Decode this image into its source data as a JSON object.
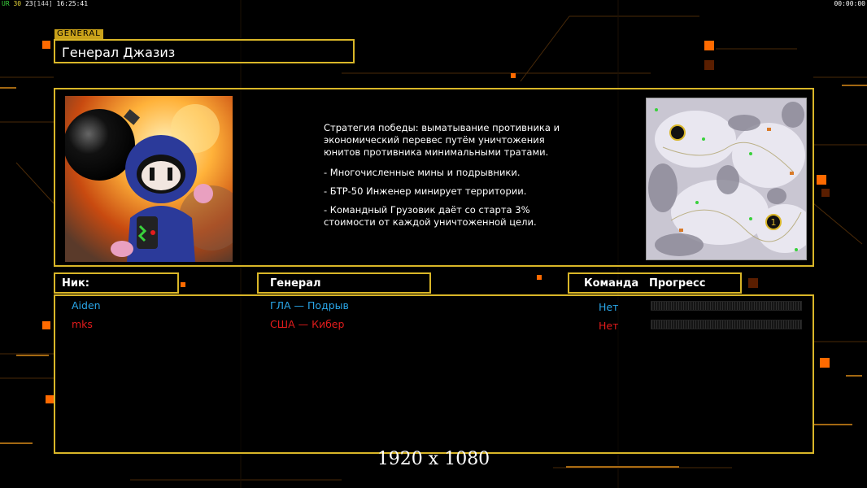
{
  "overlay": {
    "ur_label": "UR",
    "fps_value": "30",
    "cap_value": "23",
    "cap_limit": "[144]",
    "clock": "16:25:41",
    "timer": "00:00:00"
  },
  "general": {
    "tag": "GENERAL",
    "name": "Генерал Джазиз",
    "strategy": "Стратегия победы: выматывание противника и экономический перевес путём уничтожения юнитов противника минимальными тратами.",
    "features": [
      "- Многочисленные мины и подрывники.",
      "- БТР-50 Инженер минирует территории.",
      "- Командный Грузовик даёт со старта 3% стоимости от каждой уничтоженной цели."
    ],
    "portrait_icon": "bomberman-portrait",
    "minimap_icon": "snow-map-minimap"
  },
  "columns": {
    "nick": "Ник:",
    "general": "Генерал",
    "team": "Команда",
    "progress": "Прогресс"
  },
  "players": [
    {
      "nick": "Aiden",
      "general": "ГЛА — Подрыв",
      "team": "Нет",
      "color": "#2aa6e8"
    },
    {
      "nick": "mks",
      "general": "США — Кибер",
      "team": "Нет",
      "color": "#e31c1c"
    }
  ],
  "resolution": "1920 x 1080",
  "colors": {
    "accent": "#d9b628",
    "orange": "#ff6a00"
  }
}
